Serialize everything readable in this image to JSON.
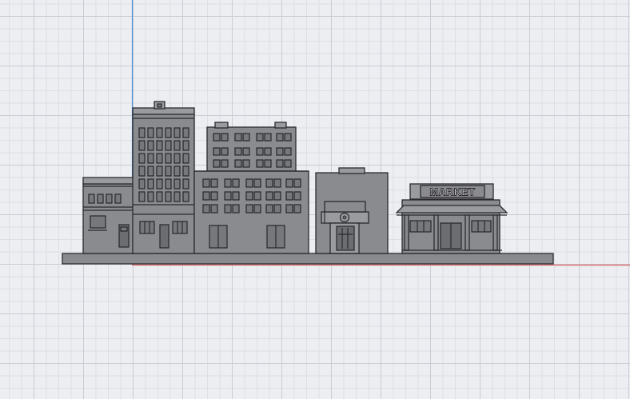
{
  "viewport": {
    "axis_colors": {
      "vertical": "#4a90d9",
      "horizontal": "#e06060"
    },
    "model_color": "#8a8b8f"
  },
  "scene": {
    "market_sign": "MARKET"
  }
}
